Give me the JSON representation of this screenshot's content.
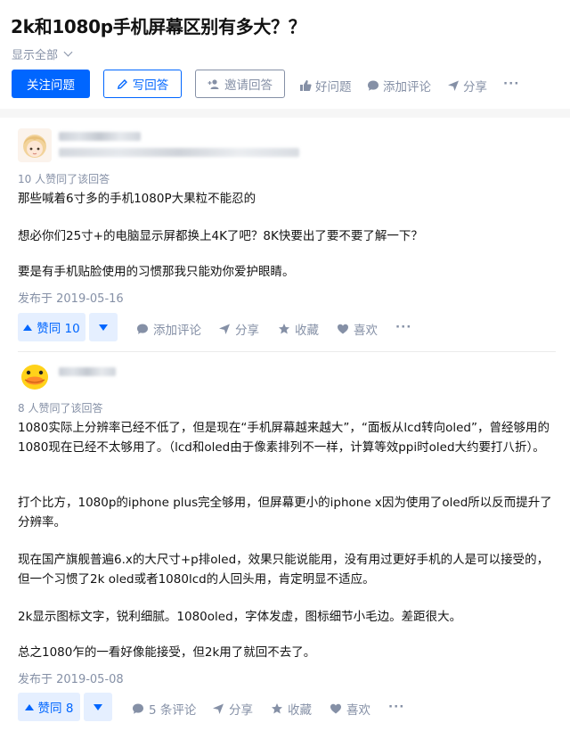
{
  "question": {
    "title": "2k和1080p手机屏幕区别有多大？？",
    "show_all": "显示全部",
    "buttons": {
      "follow": "关注问题",
      "write": "写回答",
      "invite": "邀请回答"
    },
    "actions": {
      "good": "好问题",
      "comment": "添加评论",
      "share": "分享",
      "more": "···"
    }
  },
  "answers": [
    {
      "agree_count_text": "10 人赞同了该回答",
      "paragraphs": [
        "那些喊着6寸多的手机1080P大果粒不能忍的",
        "想必你们25寸+的电脑显示屏都换上4K了吧？8K快要出了要不要了解一下？",
        "要是有手机贴脸使用的习惯那我只能劝你爱护眼睛。"
      ],
      "date": "发布于 2019-05-16",
      "vote_label": "赞同 10",
      "comment_label": "添加评论",
      "share_label": "分享",
      "collect_label": "收藏",
      "like_label": "喜欢",
      "more": "···"
    },
    {
      "agree_count_text": "8 人赞同了该回答",
      "paragraphs": [
        "1080实际上分辨率已经不低了，但是现在“手机屏幕越来越大”，“面板从lcd转向oled”，曾经够用的1080现在已经不太够用了。（lcd和oled由于像素排列不一样，计算等效ppi时oled大约要打八折）。",
        "打个比方，1080p的iphone plus完全够用，但屏幕更小的iphone x因为使用了oled所以反而提升了分辨率。",
        "现在国产旗舰普遍6.x的大尺寸+p排oled，效果只能说能用，没有用过更好手机的人是可以接受的，但一个习惯了2k oled或者1080lcd的人回头用，肯定明显不适应。",
        "2k显示图标文字，锐利细腻。1080oled，字体发虚，图标细节小毛边。差距很大。",
        "总之1080乍的一看好像能接受，但2k用了就回不去了。"
      ],
      "date": "发布于 2019-05-08",
      "vote_label": "赞同 8",
      "comment_label": "5 条评论",
      "share_label": "分享",
      "collect_label": "收藏",
      "like_label": "喜欢",
      "more": "···"
    }
  ],
  "colors": {
    "brand": "#0066ff",
    "muted": "#8590a6",
    "vote_bg": "#e5efff"
  }
}
